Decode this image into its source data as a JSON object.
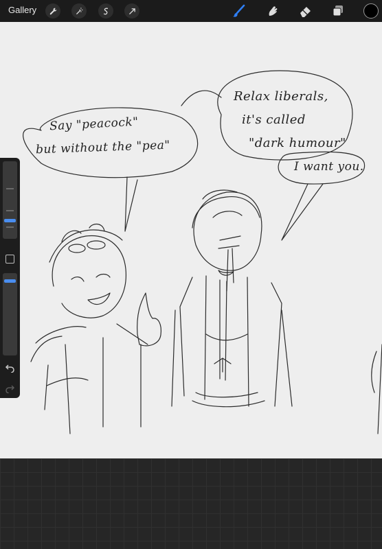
{
  "toolbar": {
    "gallery_label": "Gallery",
    "left_tools": [
      "wrench-icon",
      "magic-wand-icon",
      "selection-icon",
      "transform-arrow-icon"
    ],
    "right_tools": [
      "brush-icon",
      "smudge-icon",
      "eraser-icon",
      "layers-icon"
    ],
    "active_tool": "brush",
    "active_color": "#000000",
    "accent_color": "#2f7ff5"
  },
  "sidebar": {
    "brush_size_level": 0.6,
    "opacity_level": 0.9
  },
  "canvas": {
    "bubble_1": {
      "line_1": "Say \"peacock\"",
      "line_2": "but without the \"pea\""
    },
    "bubble_2": {
      "line_1": "Relax liberals,",
      "line_2": "it's called",
      "line_3": "\"dark humour\""
    },
    "bubble_3": {
      "line_1": "I want you."
    }
  }
}
